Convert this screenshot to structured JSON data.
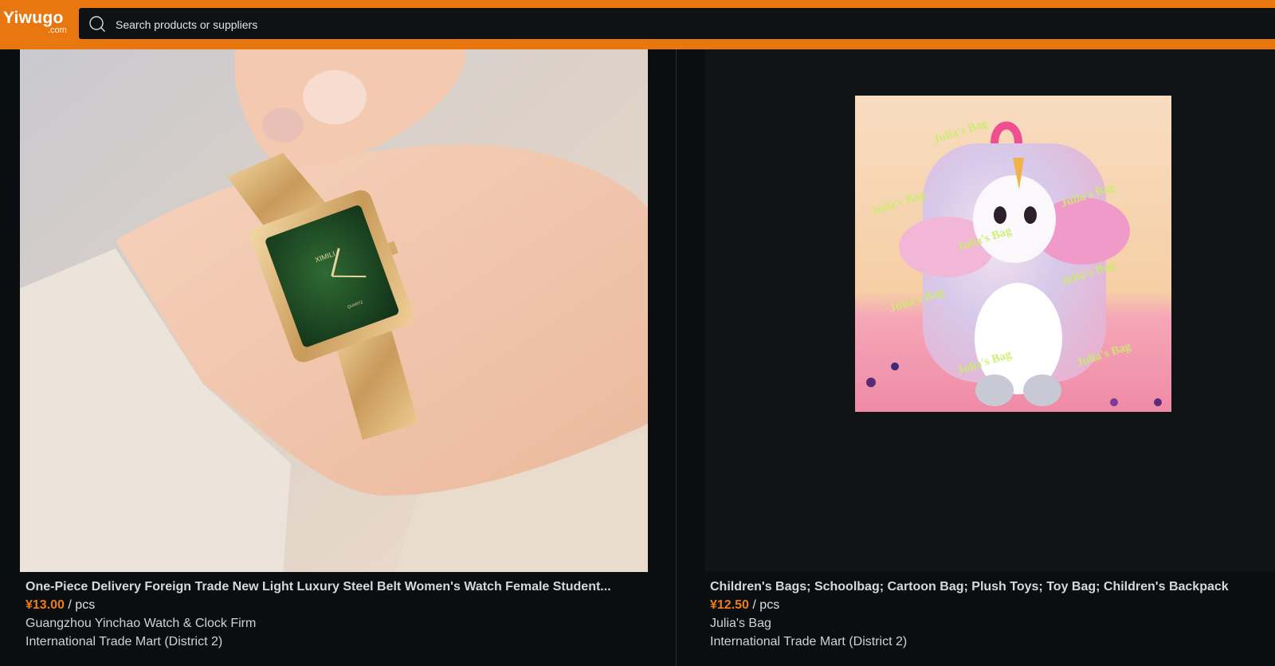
{
  "header": {
    "logo_main": "Yiwugo",
    "logo_sub": ".com",
    "search_placeholder": "Search products or suppliers"
  },
  "products": [
    {
      "title": "One-Piece Delivery Foreign Trade New Light Luxury Steel Belt Women's Watch Female Student...",
      "currency": "¥",
      "price": "13.00",
      "unit": " / pcs",
      "supplier": "Guangzhou Yinchao Watch & Clock Firm",
      "market": "International Trade Mart (District 2)",
      "image": {
        "brand_text": "XIMILI",
        "dial_text": "QUARTZ",
        "dial_color": "#1f4a22",
        "case_color": "#d4aa6a"
      }
    },
    {
      "title": "Children's Bags; Schoolbag; Cartoon Bag; Plush Toys; Toy Bag; Children's Backpack",
      "currency": "¥",
      "price": "12.50",
      "unit": " / pcs",
      "supplier": "Julia's Bag",
      "market": "International Trade Mart (District 2)",
      "image": {
        "watermark": "Julia's Bag",
        "bg_color": "#f6d9b8",
        "accent_color": "#f2a0c8"
      }
    }
  ],
  "colors": {
    "header_bg": "#e8770f",
    "search_bg": "#0f1215",
    "page_bg": "#0b0e11",
    "price": "#f07d14"
  }
}
